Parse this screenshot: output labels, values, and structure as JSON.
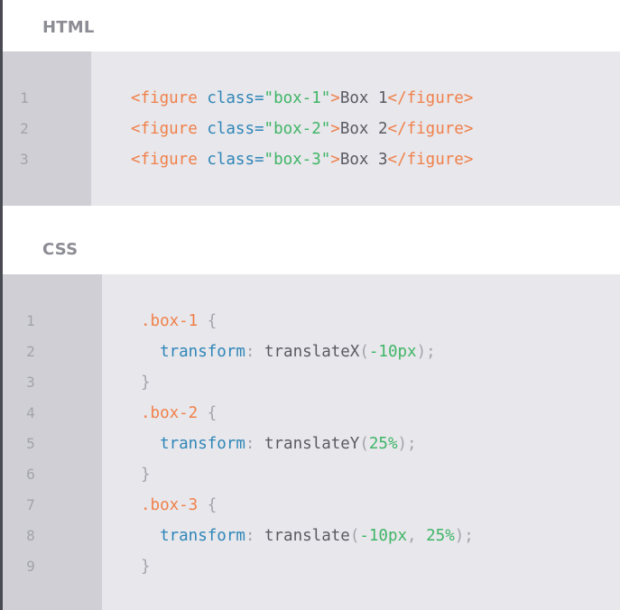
{
  "html_section": {
    "title": "HTML",
    "line_numbers": [
      "1",
      "2",
      "3"
    ],
    "lines": [
      {
        "open": "<figure",
        "attr": "class=",
        "value": "\"box-1\"",
        "close": ">",
        "text": "Box 1",
        "end": "</figure>"
      },
      {
        "open": "<figure",
        "attr": "class=",
        "value": "\"box-2\"",
        "close": ">",
        "text": "Box 2",
        "end": "</figure>"
      },
      {
        "open": "<figure",
        "attr": "class=",
        "value": "\"box-3\"",
        "close": ">",
        "text": "Box 3",
        "end": "</figure>"
      }
    ]
  },
  "css_section": {
    "title": "CSS",
    "line_numbers": [
      "1",
      "2",
      "3",
      "4",
      "5",
      "6",
      "7",
      "8",
      "9"
    ],
    "lines": [
      {
        "selector": ".box-1",
        "brace": " {"
      },
      {
        "indent": "  ",
        "prop": "transform",
        "colon": ": ",
        "fn": "translateX",
        "lp": "(",
        "args": "-10px",
        "rp": ");"
      },
      {
        "brace": "}"
      },
      {
        "selector": ".box-2",
        "brace": " {"
      },
      {
        "indent": "  ",
        "prop": "transform",
        "colon": ": ",
        "fn": "translateY",
        "lp": "(",
        "args": "25%",
        "rp": ");"
      },
      {
        "brace": "}"
      },
      {
        "selector": ".box-3",
        "brace": " {"
      },
      {
        "indent": "  ",
        "prop": "transform",
        "colon": ": ",
        "fn": "translate",
        "lp": "(",
        "args": "-10px",
        "sep": ", ",
        "args2": "25%",
        "rp": ");"
      },
      {
        "brace": "}"
      }
    ]
  },
  "colors": {
    "tag": "#f0804a",
    "attribute": "#2f86b8",
    "string": "#3fb567",
    "text": "#5a5a62",
    "punctuation": "#a3a3ab",
    "code_background": "#e8e7eb",
    "gutter_background": "#cfcfd5"
  }
}
